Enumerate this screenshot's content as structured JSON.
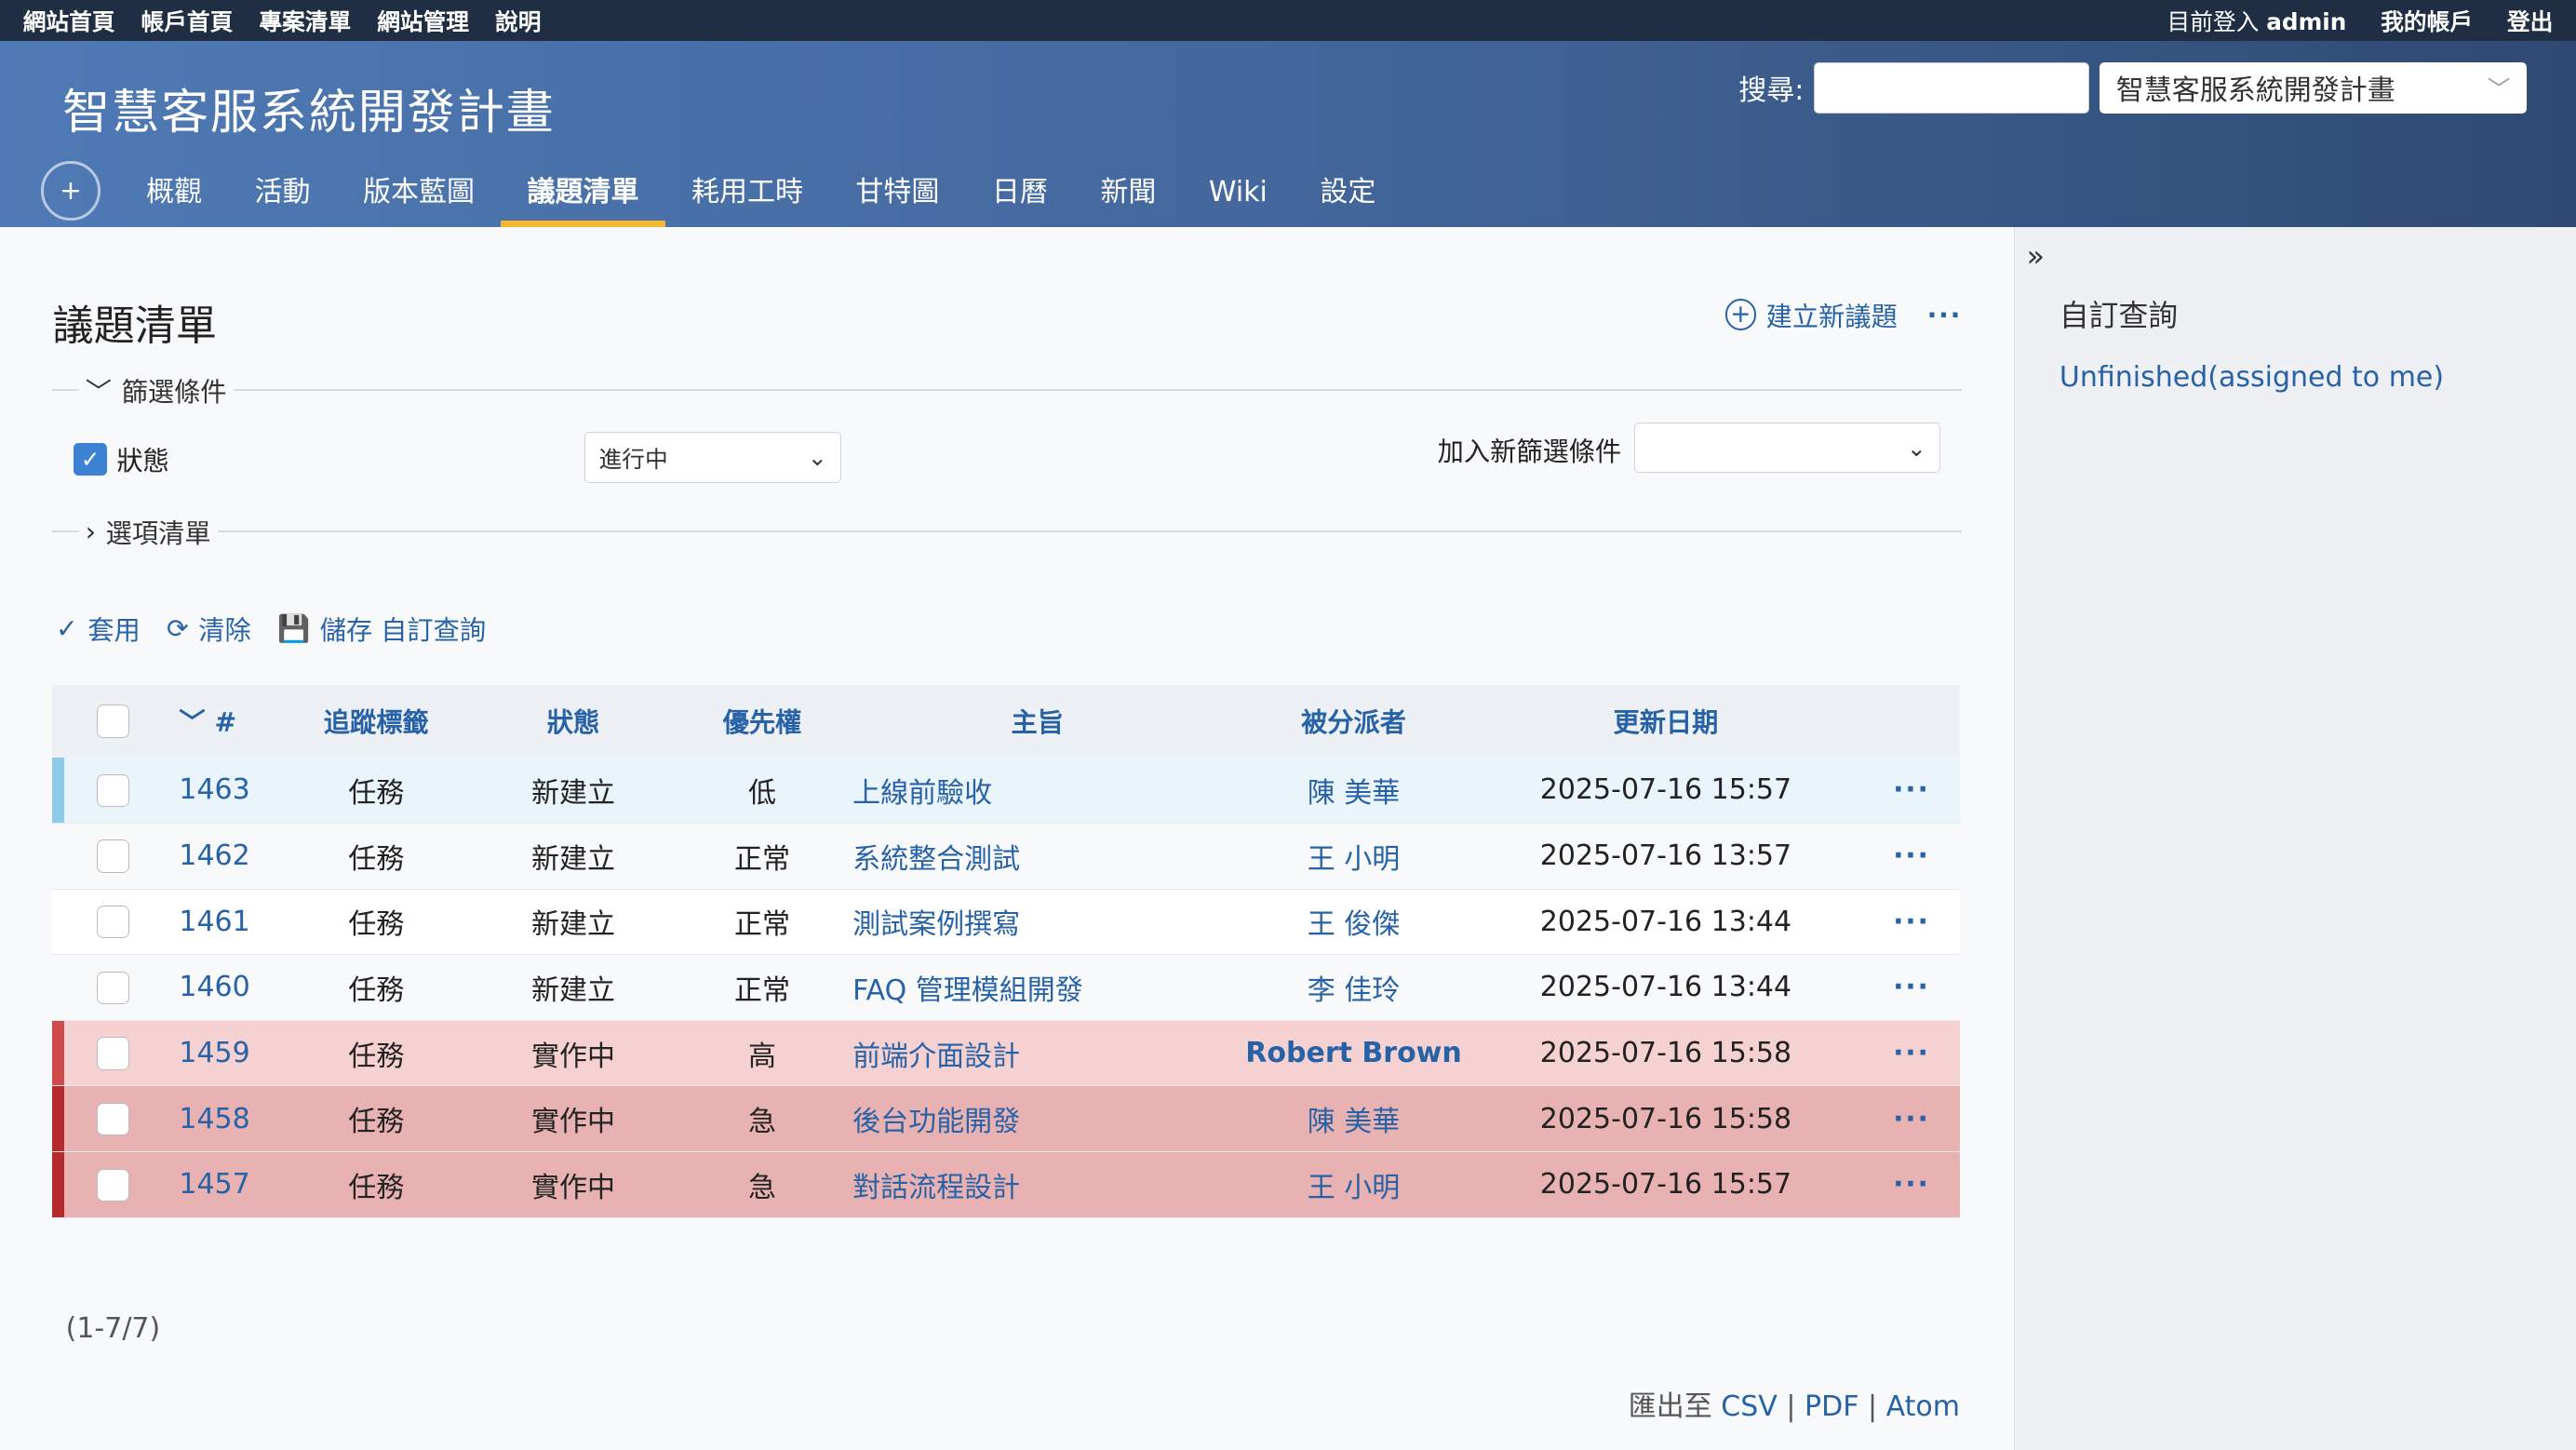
{
  "topbar": {
    "left": [
      "網站首頁",
      "帳戶首頁",
      "專案清單",
      "網站管理",
      "說明"
    ],
    "logged_in_prefix": "目前登入",
    "user": "admin",
    "my_account": "我的帳戶",
    "logout": "登出"
  },
  "header": {
    "title": "智慧客服系統開發計畫",
    "search_label": "搜尋:",
    "project_select": "智慧客服系統開發計畫",
    "tabs": [
      "概觀",
      "活動",
      "版本藍圖",
      "議題清單",
      "耗用工時",
      "甘特圖",
      "日曆",
      "新聞",
      "Wiki",
      "設定"
    ],
    "active_tab": "議題清單",
    "plus": "+"
  },
  "main": {
    "page_title": "議題清單",
    "new_issue": "建立新議題",
    "filters_legend": "篩選條件",
    "status_label": "狀態",
    "status_value": "進行中",
    "add_filter_label": "加入新篩選條件",
    "options_legend": "選項清單",
    "apply": "套用",
    "clear": "清除",
    "save_query": "儲存 自訂查詢"
  },
  "table": {
    "headers": [
      "#",
      "追蹤標籤",
      "狀態",
      "優先權",
      "主旨",
      "被分派者",
      "更新日期"
    ],
    "rows": [
      {
        "id": "1463",
        "tracker": "任務",
        "status": "新建立",
        "priority": "低",
        "subject": "上線前驗收",
        "assignee": "陳 美華",
        "updated": "2025-07-16 15:57"
      },
      {
        "id": "1462",
        "tracker": "任務",
        "status": "新建立",
        "priority": "正常",
        "subject": "系統整合測試",
        "assignee": "王 小明",
        "updated": "2025-07-16 13:57"
      },
      {
        "id": "1461",
        "tracker": "任務",
        "status": "新建立",
        "priority": "正常",
        "subject": "測試案例撰寫",
        "assignee": "王 俊傑",
        "updated": "2025-07-16 13:44"
      },
      {
        "id": "1460",
        "tracker": "任務",
        "status": "新建立",
        "priority": "正常",
        "subject": "FAQ 管理模組開發",
        "assignee": "李 佳玲",
        "updated": "2025-07-16 13:44"
      },
      {
        "id": "1459",
        "tracker": "任務",
        "status": "實作中",
        "priority": "高",
        "subject": "前端介面設計",
        "assignee": "Robert Brown",
        "updated": "2025-07-16 15:58"
      },
      {
        "id": "1458",
        "tracker": "任務",
        "status": "實作中",
        "priority": "急",
        "subject": "後台功能開發",
        "assignee": "陳 美華",
        "updated": "2025-07-16 15:58"
      },
      {
        "id": "1457",
        "tracker": "任務",
        "status": "實作中",
        "priority": "急",
        "subject": "對話流程設計",
        "assignee": "王 小明",
        "updated": "2025-07-16 15:57"
      }
    ],
    "more": "···"
  },
  "footer": {
    "count": "(1-7/7)",
    "export_prefix": "匯出至",
    "csv": "CSV",
    "pdf": "PDF",
    "atom": "Atom",
    "sep": "|"
  },
  "sidebar": {
    "toggle": "»",
    "title": "自訂查詢",
    "query_link": "Unfinished(assigned to me)"
  },
  "colors": {
    "topbar": "#1f2e43",
    "accent": "#2862a6",
    "tab_underline": "#f5b831",
    "priority_high": "#f6d1d1",
    "priority_urgent": "#e8b2b2"
  }
}
